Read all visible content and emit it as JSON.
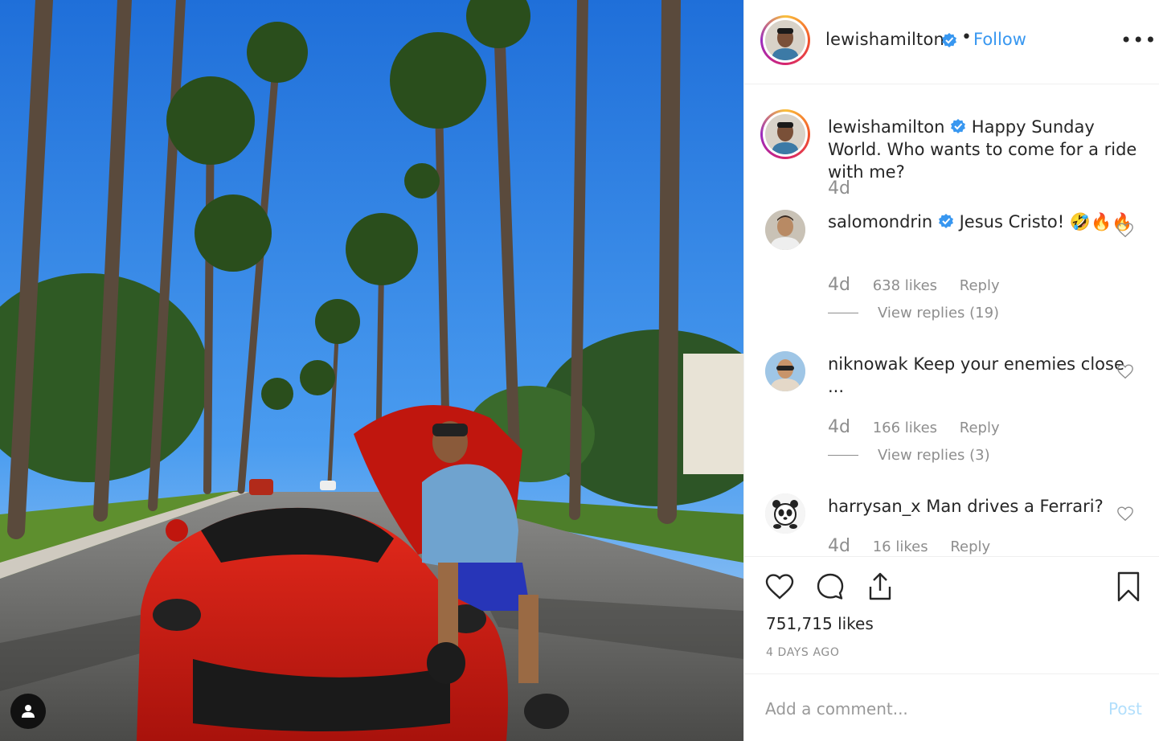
{
  "post": {
    "username": "lewishamilton",
    "follow_label": "Follow",
    "separator": "•",
    "more_label": "•••"
  },
  "caption": {
    "username": "lewishamilton",
    "text": "Happy Sunday World. Who wants to come for a ride with me?",
    "time": "4d"
  },
  "comments": [
    {
      "username": "salomondrin",
      "text": "Jesus Cristo! 🤣🔥🔥",
      "time": "4d",
      "likes": "638 likes",
      "reply_label": "Reply",
      "view_replies": "View replies (19)"
    },
    {
      "username": "niknowak",
      "text": "Keep your enemies close ...",
      "time": "4d",
      "likes": "166 likes",
      "reply_label": "Reply",
      "view_replies": "View replies (3)"
    },
    {
      "username": "harrysan_x",
      "text": "Man drives a Ferrari?",
      "time": "4d",
      "likes": "16 likes",
      "reply_label": "Reply"
    }
  ],
  "actions": {
    "likes": "751,715 likes",
    "timestamp": "4 DAYS AGO"
  },
  "add_comment": {
    "placeholder": "Add a comment...",
    "post_label": "Post"
  },
  "icons": {
    "like": "heart-icon",
    "comment": "comment-bubble-icon",
    "share": "share-icon",
    "save": "bookmark-icon",
    "tag": "user-tag-icon",
    "verified": "verified-badge-icon"
  },
  "colors": {
    "link_blue": "#3897f0",
    "post_disabled": "#b2dffc",
    "muted_text": "#8e8e8e",
    "verified_blue": "#3897f0"
  }
}
